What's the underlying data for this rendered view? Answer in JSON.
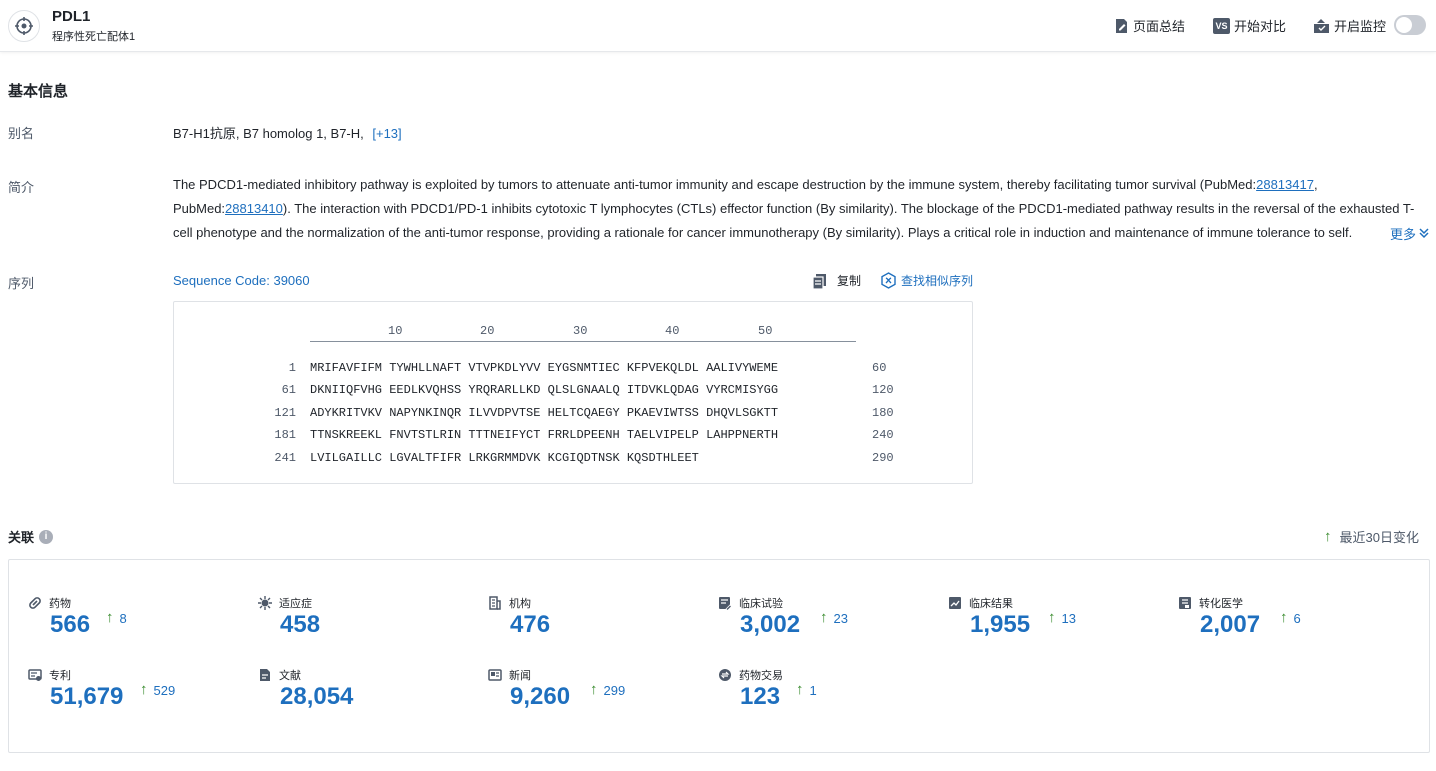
{
  "header": {
    "title": "PDL1",
    "subtitle": "程序性死亡配体1",
    "summary_label": "页面总结",
    "compare_label": "开始对比",
    "compare_badge": "VS",
    "monitor_label": "开启监控"
  },
  "basic": {
    "section_title": "基本信息",
    "alias_label": "别名",
    "aliases": "B7-H1抗原, B7 homolog 1, B7-H,",
    "alias_more": "[+13]",
    "intro_label": "简介",
    "intro_1": "The PDCD1-mediated inhibitory pathway is exploited by tumors to attenuate anti-tumor immunity and escape destruction by the immune system, thereby facilitating tumor survival (PubMed:",
    "intro_link1": "28813417",
    "intro_2": ", PubMed:",
    "intro_link2": "28813410",
    "intro_3": "). The interaction with PDCD1/PD-1 inhibits cytotoxic T lymphocytes (CTLs) effector function (By similarity). The blockage of the PDCD1-mediated pathway results in the reversal of the exhausted T-cell phenotype and the normalization of the anti-tumor response, providing a rationale for cancer immunotherapy (By similarity). Plays a critical role in induction and maintenance of immune tolerance to self.",
    "more_label": "更多",
    "seq_label": "序列",
    "seq_code": "Sequence Code: 39060",
    "copy_label": "复制",
    "find_similar_label": "查找相似序列"
  },
  "sequence": {
    "ticks": [
      "10",
      "20",
      "30",
      "40",
      "50"
    ],
    "rows": [
      {
        "start": "1",
        "seq": "MRIFAVFIFM TYWHLLNAFT VTVPKDLYVV EYGSNMTIEC KFPVEKQLDL AALIVYWEME",
        "end": "60"
      },
      {
        "start": "61",
        "seq": "DKNIIQFVHG EEDLKVQHSS YRQRARLLKD QLSLGNAALQ ITDVKLQDAG VYRCMISYGG",
        "end": "120"
      },
      {
        "start": "121",
        "seq": "ADYKRITVKV NAPYNKINQR ILVVDPVTSE HELTCQAEGY PKAEVIWTSS DHQVLSGKTT",
        "end": "180"
      },
      {
        "start": "181",
        "seq": "TTNSKREEKL FNVTSTLRIN TTTNEIFYCT FRRLDPEENH TAELVIPELP LAHPPNERTH",
        "end": "240"
      },
      {
        "start": "241",
        "seq": "LVILGAILLC LGVALTFIFR LRKGRMMDVK KCGIQDTNSK KQSDTHLEET",
        "end": "290"
      }
    ]
  },
  "assoc": {
    "title": "关联",
    "info_icon": "i",
    "recent_label": "最近30日变化",
    "up_arrow": "↑",
    "stats": [
      {
        "label": "药物",
        "value": "566",
        "change": "8",
        "icon": "pill-icon"
      },
      {
        "label": "适应症",
        "value": "458",
        "change": "",
        "icon": "virus-icon"
      },
      {
        "label": "机构",
        "value": "476",
        "change": "",
        "icon": "building-icon"
      },
      {
        "label": "临床试验",
        "value": "3,002",
        "change": "23",
        "icon": "clipboard-icon"
      },
      {
        "label": "临床结果",
        "value": "1,955",
        "change": "13",
        "icon": "chart-doc-icon"
      },
      {
        "label": "转化医学",
        "value": "2,007",
        "change": "6",
        "icon": "flask-doc-icon"
      },
      {
        "label": "专利",
        "value": "51,679",
        "change": "529",
        "icon": "patent-icon"
      },
      {
        "label": "文献",
        "value": "28,054",
        "change": "",
        "icon": "document-icon"
      },
      {
        "label": "新闻",
        "value": "9,260",
        "change": "299",
        "icon": "news-icon"
      },
      {
        "label": "药物交易",
        "value": "123",
        "change": "1",
        "icon": "deal-icon"
      }
    ]
  }
}
